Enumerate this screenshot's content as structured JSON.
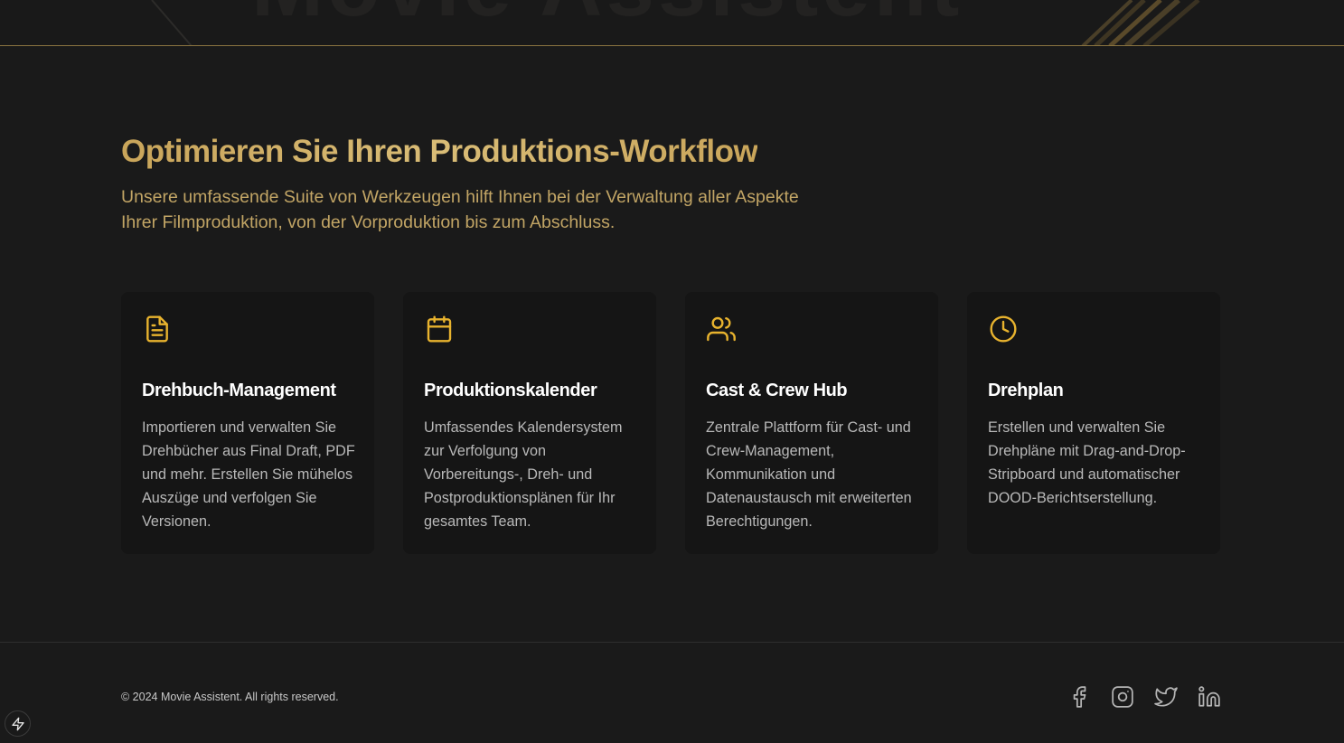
{
  "hero": {
    "ghost_text": "Movie Assistent"
  },
  "features": {
    "title": "Optimieren Sie Ihren Produktions-Workflow",
    "subtitle": "Unsere umfassende Suite von Werkzeugen hilft Ihnen bei der Verwaltung aller Aspekte Ihrer Filmproduktion, von der Vorproduktion bis zum Abschluss.",
    "cards": [
      {
        "icon": "document-icon",
        "title": "Drehbuch-Management",
        "text": "Importieren und verwalten Sie Drehbücher aus Final Draft, PDF und mehr. Erstellen Sie mühelos Auszüge und verfolgen Sie Versionen."
      },
      {
        "icon": "calendar-icon",
        "title": "Produktionskalender",
        "text": "Umfassendes Kalendersystem zur Verfolgung von Vorbereitungs-, Dreh- und Postproduktionsplänen für Ihr gesamtes Team."
      },
      {
        "icon": "users-icon",
        "title": "Cast & Crew Hub",
        "text": "Zentrale Plattform für Cast- und Crew-Management, Kommunikation und Datenaustausch mit erweiterten Berechtigungen."
      },
      {
        "icon": "clock-icon",
        "title": "Drehplan",
        "text": "Erstellen und verwalten Sie Drehpläne mit Drag-and-Drop-Stripboard und automatischer DOOD-Berichtserstellung."
      }
    ]
  },
  "footer": {
    "copyright": "© 2024 Movie Assistent. All rights reserved.",
    "social": [
      "facebook-icon",
      "instagram-icon",
      "twitter-icon",
      "linkedin-icon"
    ]
  },
  "colors": {
    "accent": "#e8b32e",
    "title_gold": "#c9a55a",
    "background": "#1a1a1a",
    "card": "#151515"
  }
}
